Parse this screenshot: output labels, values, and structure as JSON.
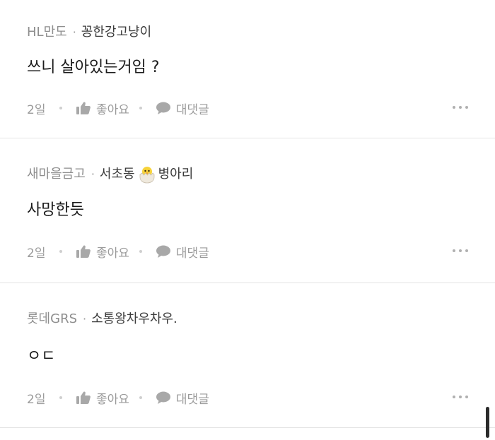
{
  "comments": [
    {
      "org": "HL만도",
      "separator": "·",
      "nickname": "꽁한강고냥이",
      "text": "쓰니 살아있는거임 ?",
      "date": "2일",
      "like_label": "좋아요",
      "reply_label": "대댓글"
    },
    {
      "org": "새마을금고",
      "separator": "·",
      "nickname": "서초동",
      "nickname_suffix": "병아리",
      "badge_icon": "hatching-chick-icon",
      "text": "사망한듯",
      "date": "2일",
      "like_label": "좋아요",
      "reply_label": "대댓글"
    },
    {
      "org": "롯데GRS",
      "separator": "·",
      "nickname": "소통왕차우차우.",
      "text": "ㅇㄷ",
      "date": "2일",
      "like_label": "좋아요",
      "reply_label": "대댓글"
    }
  ],
  "icons": {
    "like": "thumbs-up-icon",
    "reply": "speech-bubble-icon",
    "more": "more-options-icon"
  },
  "colors": {
    "text": "#1b1b1b",
    "muted": "#9b9b9b",
    "divider": "#e4e4e4"
  }
}
